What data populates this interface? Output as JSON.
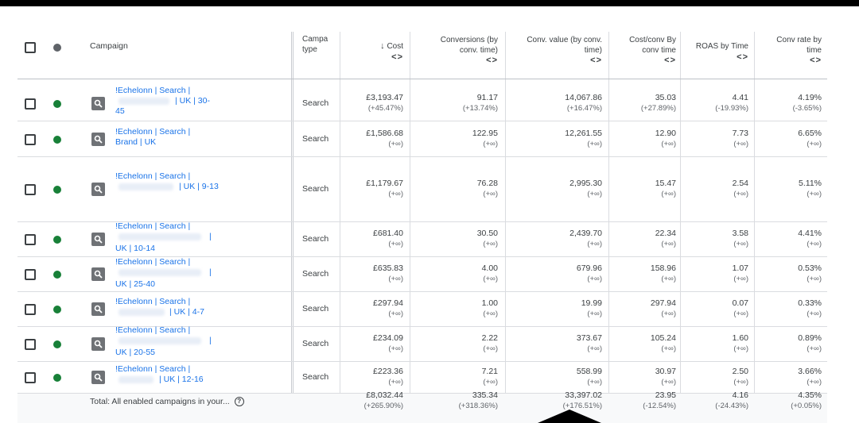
{
  "header": {
    "campaign": "Campaign",
    "campaign_type": [
      "Campa",
      "type"
    ],
    "cost": "Cost",
    "conversions": [
      "Conversions (by",
      "conv. time)"
    ],
    "conv_value": [
      "Conv. value (by conv.",
      "time)"
    ],
    "cost_conv": [
      "Cost/conv By",
      "conv time"
    ],
    "roas": "ROAS by Time",
    "conv_rate": [
      "Conv rate by",
      "time"
    ],
    "sort_arrow": "↓",
    "expand_arrows": "<>"
  },
  "rows": [
    {
      "name": [
        "!Echelonn | Search |",
        "| UK | 30-",
        "45"
      ],
      "type": "Search",
      "cost": "£3,193.47",
      "cost_d": "(+45.47%)",
      "conv": "91.17",
      "conv_d": "(+13.74%)",
      "val": "14,067.86",
      "val_d": "(+16.47%)",
      "cpc": "35.03",
      "cpc_d": "(+27.89%)",
      "roas": "4.41",
      "roas_d": "(-19.93%)",
      "rate": "4.19%",
      "rate_d": "(-3.65%)"
    },
    {
      "name": [
        "!Echelonn | Search |",
        "Brand | UK"
      ],
      "type": "Search",
      "cost": "£1,586.68",
      "cost_d": "(+∞)",
      "conv": "122.95",
      "conv_d": "(+∞)",
      "val": "12,261.55",
      "val_d": "(+∞)",
      "cpc": "12.90",
      "cpc_d": "(+∞)",
      "roas": "7.73",
      "roas_d": "(+∞)",
      "rate": "6.65%",
      "rate_d": "(+∞)"
    },
    {
      "name": [
        "!Echelonn | Search |",
        "| UK | 9-13"
      ],
      "type": "Search",
      "cost": "£1,179.67",
      "cost_d": "(+∞)",
      "conv": "76.28",
      "conv_d": "(+∞)",
      "val": "2,995.30",
      "val_d": "(+∞)",
      "cpc": "15.47",
      "cpc_d": "(+∞)",
      "roas": "2.54",
      "roas_d": "(+∞)",
      "rate": "5.11%",
      "rate_d": "(+∞)"
    },
    {
      "name": [
        "!Echelonn | Search |",
        "|",
        "UK | 10-14"
      ],
      "type": "Search",
      "cost": "£681.40",
      "cost_d": "(+∞)",
      "conv": "30.50",
      "conv_d": "(+∞)",
      "val": "2,439.70",
      "val_d": "(+∞)",
      "cpc": "22.34",
      "cpc_d": "(+∞)",
      "roas": "3.58",
      "roas_d": "(+∞)",
      "rate": "4.41%",
      "rate_d": "(+∞)"
    },
    {
      "name": [
        "!Echelonn | Search |",
        "|",
        "UK | 25-40"
      ],
      "type": "Search",
      "cost": "£635.83",
      "cost_d": "(+∞)",
      "conv": "4.00",
      "conv_d": "(+∞)",
      "val": "679.96",
      "val_d": "(+∞)",
      "cpc": "158.96",
      "cpc_d": "(+∞)",
      "roas": "1.07",
      "roas_d": "(+∞)",
      "rate": "0.53%",
      "rate_d": "(+∞)"
    },
    {
      "name": [
        "!Echelonn | Search |",
        "| UK | 4-7"
      ],
      "type": "Search",
      "cost": "£297.94",
      "cost_d": "(+∞)",
      "conv": "1.00",
      "conv_d": "(+∞)",
      "val": "19.99",
      "val_d": "(+∞)",
      "cpc": "297.94",
      "cpc_d": "(+∞)",
      "roas": "0.07",
      "roas_d": "(+∞)",
      "rate": "0.33%",
      "rate_d": "(+∞)"
    },
    {
      "name": [
        "!Echelonn | Search |",
        "|",
        "UK | 20-55"
      ],
      "type": "Search",
      "cost": "£234.09",
      "cost_d": "(+∞)",
      "conv": "2.22",
      "conv_d": "(+∞)",
      "val": "373.67",
      "val_d": "(+∞)",
      "cpc": "105.24",
      "cpc_d": "(+∞)",
      "roas": "1.60",
      "roas_d": "(+∞)",
      "rate": "0.89%",
      "rate_d": "(+∞)"
    },
    {
      "name": [
        "!Echelonn | Search |",
        "| UK | 12-16"
      ],
      "type": "Search",
      "cost": "£223.36",
      "cost_d": "(+∞)",
      "conv": "7.21",
      "conv_d": "(+∞)",
      "val": "558.99",
      "val_d": "(+∞)",
      "cpc": "30.97",
      "cpc_d": "(+∞)",
      "roas": "2.50",
      "roas_d": "(+∞)",
      "rate": "3.66%",
      "rate_d": "(+∞)"
    }
  ],
  "total": {
    "label": "Total: All enabled campaigns in your...",
    "help": "?",
    "cost": "£8,032.44",
    "cost_d": "(+265.90%)",
    "conv": "335.34",
    "conv_d": "(+318.36%)",
    "val": "33,397.02",
    "val_d": "(+176.51%)",
    "cpc": "23.95",
    "cpc_d": "(-12.54%)",
    "roas": "4.16",
    "roas_d": "(-24.43%)",
    "rate": "4.35%",
    "rate_d": "(+0.05%)"
  },
  "colors": {
    "link": "#1a73e8",
    "enabled": "#188038"
  },
  "icons": {
    "status": "status-dot",
    "campaign_type": "search-icon"
  }
}
